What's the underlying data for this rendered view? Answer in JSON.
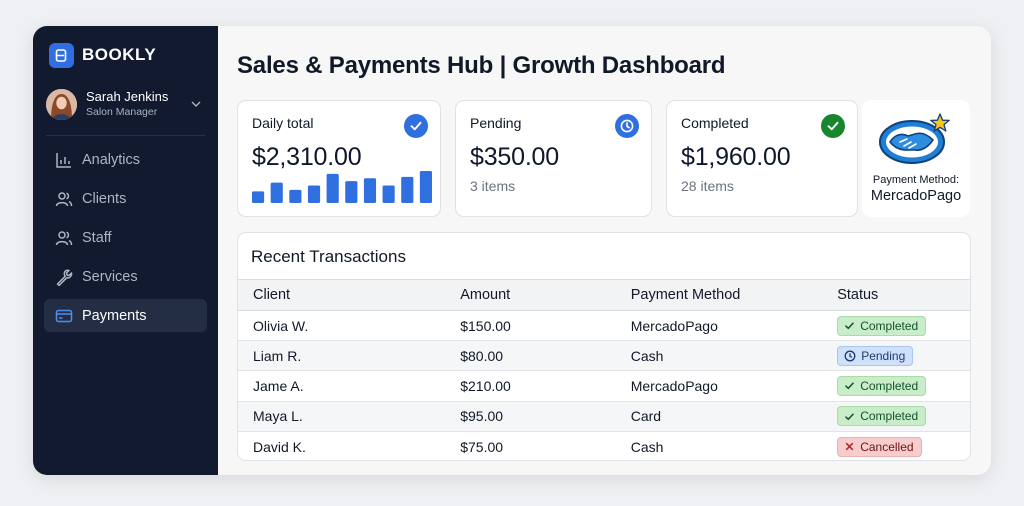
{
  "app": {
    "brand": "BOOKLY"
  },
  "user": {
    "name": "Sarah Jenkins",
    "role": "Salon Manager"
  },
  "sidebar": {
    "items": [
      {
        "label": "Analytics",
        "icon": "bar-chart-icon",
        "active": false
      },
      {
        "label": "Clients",
        "icon": "users-icon",
        "active": false
      },
      {
        "label": "Staff",
        "icon": "staff-icon",
        "active": false
      },
      {
        "label": "Services",
        "icon": "wrench-icon",
        "active": false
      },
      {
        "label": "Payments",
        "icon": "credit-card-icon",
        "active": true
      }
    ]
  },
  "header": {
    "title": "Sales & Payments Hub | Growth Dashboard"
  },
  "cards": {
    "daily": {
      "label": "Daily total",
      "value": "$2,310.00",
      "icon": "check-circle-icon",
      "icon_color": "#2f6fe0"
    },
    "pending": {
      "label": "Pending",
      "value": "$350.00",
      "sub": "3 items",
      "icon": "clock-icon",
      "icon_color": "#2f6fe0"
    },
    "completed": {
      "label": "Completed",
      "value": "$1,960.00",
      "sub": "28 items",
      "icon": "check-circle-icon",
      "icon_color": "#17862d"
    }
  },
  "payment_method": {
    "label": "Payment Method:",
    "name": "MercadoPago",
    "icon": "handshake-icon"
  },
  "transactions": {
    "title": "Recent Transactions",
    "columns": [
      "Client",
      "Amount",
      "Payment Method",
      "Status"
    ],
    "rows": [
      {
        "client": "Olivia W.",
        "amount": "$150.00",
        "method": "MercadoPago",
        "status": "Completed"
      },
      {
        "client": "Liam R.",
        "amount": "$80.00",
        "method": "Cash",
        "status": "Pending"
      },
      {
        "client": "Jame A.",
        "amount": "$210.00",
        "method": "MercadoPago",
        "status": "Completed"
      },
      {
        "client": "Maya L.",
        "amount": "$95.00",
        "method": "Card",
        "status": "Completed"
      },
      {
        "client": "David K.",
        "amount": "$75.00",
        "method": "Cash",
        "status": "Cancelled"
      }
    ]
  },
  "chart_data": {
    "type": "bar",
    "categories": [],
    "values": [
      4,
      7,
      4.5,
      6,
      10,
      7.5,
      8.5,
      6,
      9,
      11
    ]
  },
  "colors": {
    "accent": "#2f6fe0",
    "sidebar_bg": "#111a2e",
    "completed": "#17862d",
    "pending": "#2f6fe0",
    "cancelled": "#d23a3a"
  }
}
